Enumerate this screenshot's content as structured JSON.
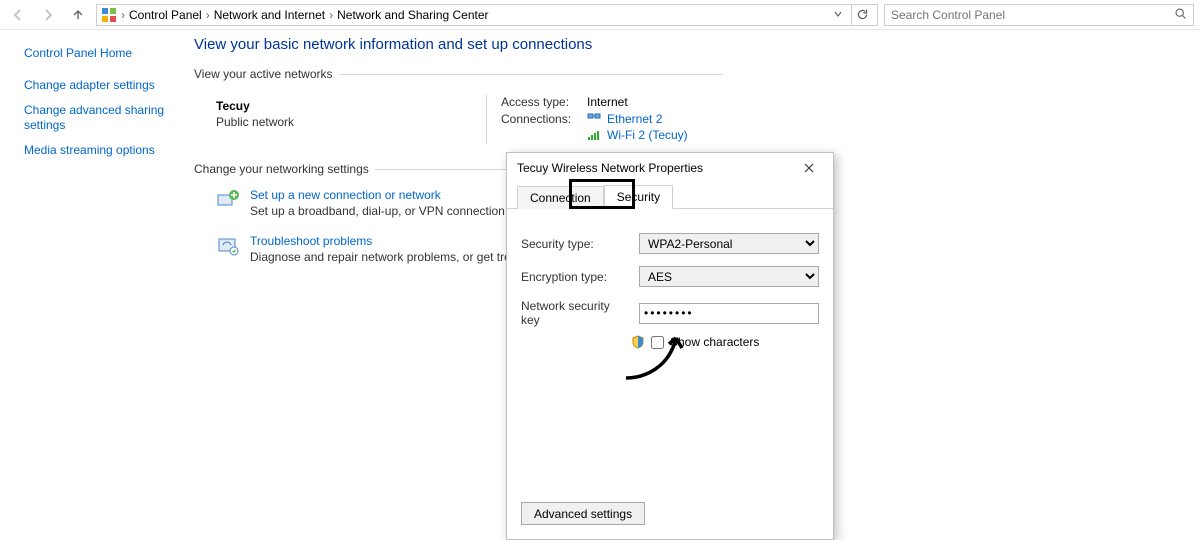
{
  "breadcrumbs": {
    "root": "Control Panel",
    "mid": "Network and Internet",
    "leaf": "Network and Sharing Center"
  },
  "search": {
    "placeholder": "Search Control Panel"
  },
  "sidebar": {
    "home": "Control Panel Home",
    "links": [
      "Change adapter settings",
      "Change advanced sharing settings",
      "Media streaming options"
    ]
  },
  "main": {
    "title": "View your basic network information and set up connections",
    "section_active": "View your active networks",
    "network": {
      "name": "Tecuy",
      "type": "Public network"
    },
    "access_label": "Access type:",
    "access_value": "Internet",
    "conn_label": "Connections:",
    "conn_eth": "Ethernet 2",
    "conn_wifi": "Wi-Fi 2 (Tecuy)",
    "section_change": "Change your networking settings",
    "items": [
      {
        "title": "Set up a new connection or network",
        "desc": "Set up a broadband, dial-up, or VPN connection; or set up a router or access point."
      },
      {
        "title": "Troubleshoot problems",
        "desc": "Diagnose and repair network problems, or get troubleshooting information."
      }
    ]
  },
  "dialog": {
    "title": "Tecuy Wireless Network Properties",
    "tab_connection": "Connection",
    "tab_security": "Security",
    "sec_type_label": "Security type:",
    "sec_type_value": "WPA2-Personal",
    "enc_label": "Encryption type:",
    "enc_value": "AES",
    "key_label": "Network security key",
    "key_value": "••••••••",
    "show_chars": "Show characters",
    "adv_button": "Advanced settings"
  }
}
